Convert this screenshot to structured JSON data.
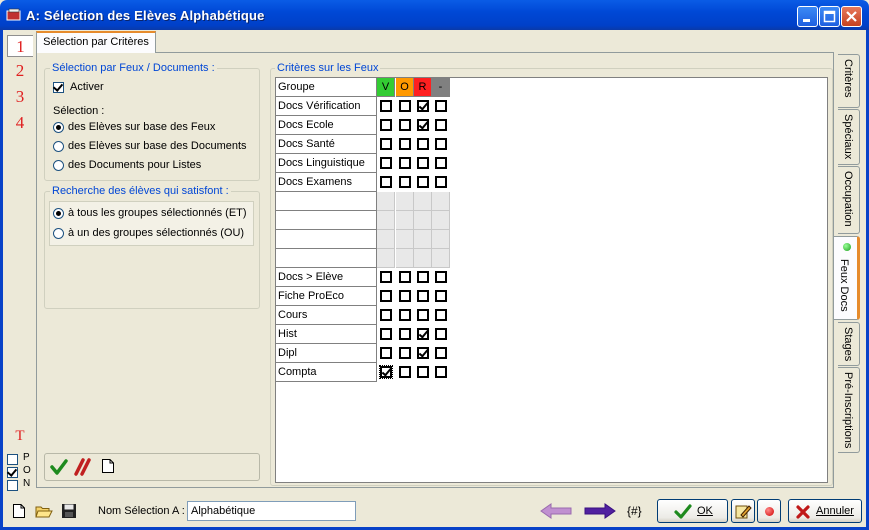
{
  "window": {
    "title": "A: Sélection des Elèves Alphabétique"
  },
  "left_tabs": [
    "1",
    "2",
    "3",
    "4"
  ],
  "left_letter": "T",
  "left_checks": [
    {
      "label": "P",
      "checked": false
    },
    {
      "label": "O",
      "checked": true
    },
    {
      "label": "N",
      "checked": false
    }
  ],
  "tab": {
    "label": "Sélection par Critères"
  },
  "feux_docs": {
    "legend": "Sélection par Feux / Documents :",
    "activer_label": "Activer",
    "activer_checked": true,
    "selection_label": "Sélection :",
    "options": [
      {
        "label": "des Elèves sur base des Feux",
        "selected": true
      },
      {
        "label": "des Elèves sur base des Documents",
        "selected": false
      },
      {
        "label": "des Documents pour Listes",
        "selected": false
      }
    ]
  },
  "recherche": {
    "legend": "Recherche des élèves qui satisfont :",
    "options": [
      {
        "label": "à tous les groupes sélectionnés (ET)",
        "selected": true
      },
      {
        "label": "à un des groupes sélectionnés (OU)",
        "selected": false
      }
    ]
  },
  "criteres": {
    "legend": "Critères sur les Feux",
    "header_label": "Groupe",
    "columns": [
      {
        "label": "V",
        "color": "#33cc33"
      },
      {
        "label": "O",
        "color": "#ff9900"
      },
      {
        "label": "R",
        "color": "#ff2020"
      },
      {
        "label": "-",
        "color": "#808080"
      }
    ],
    "rows": [
      {
        "label": "Docs Vérification",
        "checks": [
          false,
          false,
          true,
          false
        ]
      },
      {
        "label": "Docs Ecole",
        "checks": [
          false,
          false,
          true,
          false
        ]
      },
      {
        "label": "Docs Santé",
        "checks": [
          false,
          false,
          false,
          false
        ]
      },
      {
        "label": "Docs Linguistique",
        "checks": [
          false,
          false,
          false,
          false
        ]
      },
      {
        "label": "Docs Examens",
        "checks": [
          false,
          false,
          false,
          false
        ]
      },
      {
        "label": "",
        "checks": null
      },
      {
        "label": "",
        "checks": null
      },
      {
        "label": "",
        "checks": null
      },
      {
        "label": "",
        "checks": null
      },
      {
        "label": "Docs > Elève",
        "checks": [
          false,
          false,
          false,
          false
        ]
      },
      {
        "label": "Fiche ProEco",
        "checks": [
          false,
          false,
          false,
          false
        ]
      },
      {
        "label": "Cours",
        "checks": [
          false,
          false,
          false,
          false
        ]
      },
      {
        "label": "Hist",
        "checks": [
          false,
          false,
          true,
          false
        ]
      },
      {
        "label": "Dipl",
        "checks": [
          false,
          false,
          true,
          false
        ]
      },
      {
        "label": "Compta",
        "checks": [
          true,
          false,
          false,
          false
        ]
      }
    ]
  },
  "right_tabs": [
    {
      "label": "Critères",
      "active": false
    },
    {
      "label": "Spéciaux",
      "active": false
    },
    {
      "label": "Occupation",
      "active": false
    },
    {
      "label": "Feux Docs",
      "active": true
    },
    {
      "label": "Stages",
      "active": false
    },
    {
      "label": "Pré-Inscriptions",
      "active": false
    }
  ],
  "bottom": {
    "name_label": "Nom Sélection A :",
    "name_value": "Alphabétique",
    "hash_label": "{#}",
    "ok_label": "OK",
    "cancel_label": "Annuler"
  },
  "colors": {
    "accent": "#0046d5",
    "titlebar": "#0048d6",
    "red_digit": "#e02020"
  }
}
